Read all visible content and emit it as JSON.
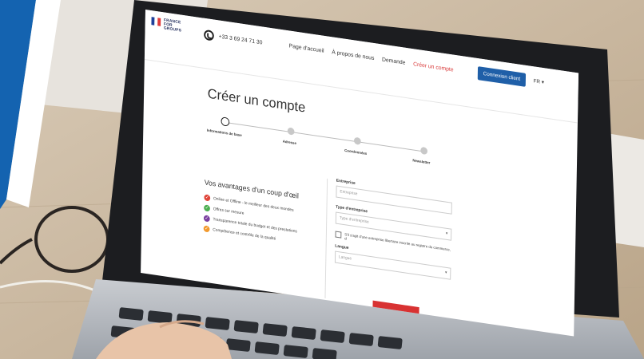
{
  "site": {
    "logo_text": [
      "FRANCE",
      "FOR",
      "GROUPS"
    ],
    "phone": "+33 3 69 24 71 30",
    "nav": [
      "Page d'accueil",
      "À propos de nous",
      "Demande",
      "Créer un compte"
    ],
    "login_button": "Connexion client",
    "lang": "FR ▾"
  },
  "page": {
    "title": "Créer un compte",
    "steps": [
      "Informations de base",
      "Adresse",
      "Coordonnées",
      "Newsletter"
    ]
  },
  "advantages": {
    "title": "Vos avantages d'un coup d'œil",
    "items": [
      {
        "text": "Online et Offline - le meilleur des deux mondes",
        "color": "#e0453a"
      },
      {
        "text": "Offres sur mesure",
        "color": "#4caf50"
      },
      {
        "text": "Transparence totale du budget et des prestations",
        "color": "#7b3fa0"
      },
      {
        "text": "Compétence et contrôle de la qualité",
        "color": "#f29a2e"
      }
    ]
  },
  "form": {
    "company_label": "Entreprise",
    "company_placeholder": "Entreprise",
    "type_label": "Type d'entreprise",
    "type_placeholder": "Type d'entreprise",
    "checkbox_text": "S'il s'agit d'une entreprise libertaire inscrite au registre du commerce, cl",
    "language_label": "Langue",
    "language_placeholder": "Langue"
  },
  "colors": {
    "brand_blue": "#1463b0",
    "primary_button": "#1f5fa8",
    "accent_red": "#d83232"
  },
  "icons": [
    "phone-icon",
    "check-icon",
    "chevron-down-icon"
  ]
}
